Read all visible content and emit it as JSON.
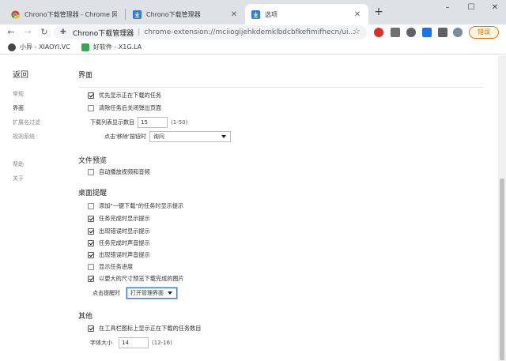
{
  "tabs": [
    {
      "title": "Chrono下载管理器 - Chrome 网",
      "active": false
    },
    {
      "title": "Chrono下载管理器",
      "active": false
    },
    {
      "title": "选项",
      "active": true
    }
  ],
  "toolbar": {
    "omnibox_title": "Chrono下载管理器",
    "omnibox_url": "chrome-extension://mciiogijehkdemklbdcbfkefimifhecn/ui...",
    "error_label": "错误"
  },
  "bookmarks": [
    {
      "label": "小异 - XIAOYI.VC"
    },
    {
      "label": "好软件 - X1G.LA"
    }
  ],
  "sidebar": {
    "back": "返回",
    "items": [
      "常规",
      "界面",
      "扩展名过滤",
      "规则系统",
      "帮助",
      "关于"
    ]
  },
  "interface": {
    "title": "界面",
    "opt_show_downloading": "优先显示正在下载的任务",
    "opt_clear_close": "清除任务后关闭弹出页面",
    "list_count_label": "下载列表显示数目",
    "list_count_value": "15",
    "list_count_range": "(1-50)",
    "remove_btn_label": "点击'移除'按钮时",
    "remove_btn_value": "询问"
  },
  "preview": {
    "title": "文件预览",
    "opt_autoplay": "自动播放视频和音频"
  },
  "notify": {
    "title": "桌面提醒",
    "opt_onekey": "添加\"一键下载\"的任务时显示提示",
    "opt_done_show": "任务完成时显示提示",
    "opt_err_show": "出现错误时显示提示",
    "opt_done_sound": "任务完成时声音提示",
    "opt_err_sound": "出现错误时声音提示",
    "opt_progress": "显示任务进度",
    "opt_bigpreview": "以更大的尺寸预览下载完成的图片",
    "click_label": "点击提醒时",
    "click_value": "打开管理界面"
  },
  "other": {
    "title": "其他",
    "opt_badge": "在工具栏图标上显示正在下载的任务数目",
    "font_label": "字体大小",
    "font_value": "14",
    "font_range": "(12-16)"
  }
}
